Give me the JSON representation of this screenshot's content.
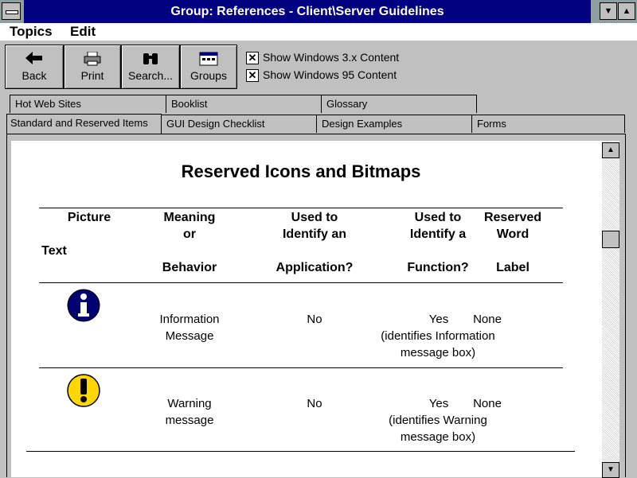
{
  "window": {
    "title": "Group: References - Client\\Server Guidelines"
  },
  "menu": {
    "items": [
      "Topics",
      "Edit"
    ]
  },
  "toolbar": {
    "buttons": [
      "Back",
      "Print",
      "Search...",
      "Groups"
    ],
    "checkboxes": [
      {
        "label": "Show Windows 3.x Content",
        "checked": true
      },
      {
        "label": "Show Windows 95 Content",
        "checked": true
      }
    ]
  },
  "tabs": {
    "back_row": [
      "Hot Web Sites",
      "Booklist",
      "Glossary"
    ],
    "front_row": [
      "Standard and Reserved Items",
      "GUI Design Checklist",
      "Design Examples",
      "Forms"
    ],
    "active": "Standard and Reserved Items"
  },
  "doc": {
    "heading": "Reserved Icons and Bitmaps",
    "columns": {
      "picture": "Picture",
      "text": "Text",
      "meaning_1": "Meaning",
      "meaning_2": "or",
      "meaning_3": "Behavior",
      "app_1": "Used to",
      "app_2": "Identify an",
      "app_3": "Application?",
      "func_1": "Used to",
      "func_2": "Identify a",
      "func_3": "Function?",
      "rw_1": "Reserved",
      "rw_2": "Word",
      "rw_3": "Label"
    },
    "rows": [
      {
        "icon": "information-icon",
        "meaning_1": "Information",
        "meaning_2": "Message",
        "app": "No",
        "func_1": "Yes",
        "func_2": "(identifies Information",
        "func_3": "message box)",
        "rw": "None"
      },
      {
        "icon": "warning-icon",
        "meaning_1": "Warning",
        "meaning_2": "message",
        "app": "No",
        "func_1": "Yes",
        "func_2": "(identifies Warning",
        "func_3": "message box)",
        "rw": "None"
      }
    ]
  },
  "colors": {
    "title_bar": "#000080",
    "info_icon": "#000070",
    "warning_icon": "#ffd700"
  }
}
